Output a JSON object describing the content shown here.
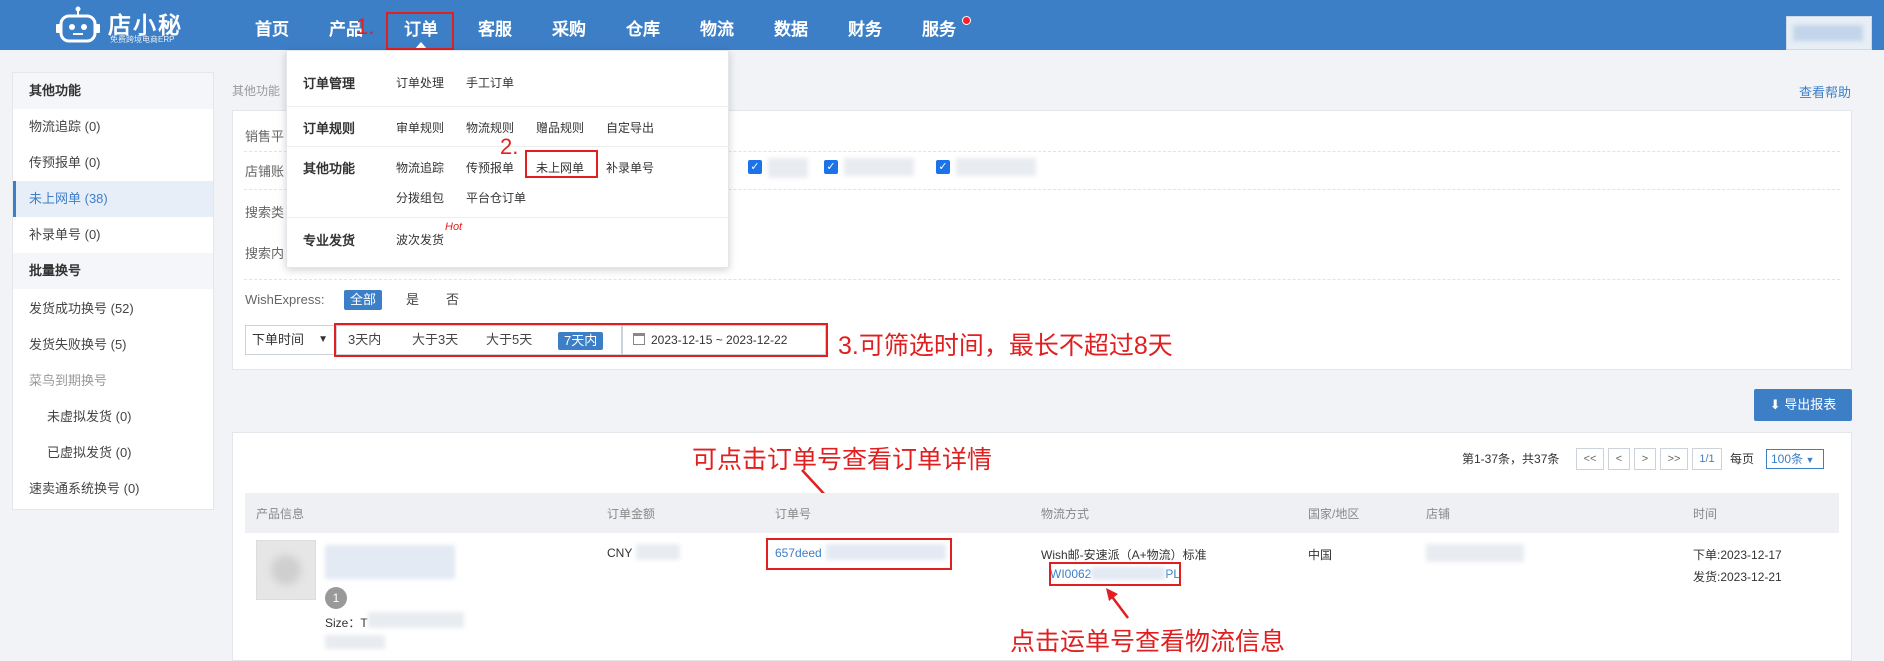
{
  "header": {
    "logo_name": "店小秘",
    "logo_sub": "免费跨境电商ERP",
    "nav": [
      "首页",
      "产品",
      "订单",
      "客服",
      "采购",
      "仓库",
      "物流",
      "数据",
      "财务",
      "服务"
    ]
  },
  "annotations": {
    "step1": "1.",
    "step2": "2.",
    "step3_note": "3.可筛选时间，最长不超过8天",
    "order_note": "可点击订单号查看订单详情",
    "tracking_note": "点击运单号查看物流信息"
  },
  "dropdown": {
    "groups": [
      {
        "title": "订单管理",
        "items": [
          "订单处理",
          "手工订单"
        ]
      },
      {
        "title": "订单规则",
        "items": [
          "审单规则",
          "物流规则",
          "赠品规则",
          "自定导出"
        ]
      },
      {
        "title": "其他功能",
        "items": [
          "物流追踪",
          "传预报单",
          "未上网单",
          "补录单号",
          "分拨组包",
          "平台仓订单"
        ]
      },
      {
        "title": "专业发货",
        "items": [
          "波次发货"
        ],
        "tag": "Hot"
      }
    ]
  },
  "sidebar": {
    "section1_title": "其他功能",
    "section1_items": [
      "物流追踪 (0)",
      "传预报单 (0)",
      "未上网单 (38)",
      "补录单号 (0)"
    ],
    "section2_title": "批量换号",
    "section2_items": [
      "发货成功换号 (52)",
      "发货失败换号 (5)",
      "菜鸟到期换号",
      "未虚拟发货 (0)",
      "已虚拟发货 (0)",
      "速卖通系统换号 (0)"
    ]
  },
  "page": {
    "breadcrumb": "其他功能",
    "help": "查看帮助"
  },
  "filters": {
    "sales_platform_label": "销售平",
    "store_label": "店铺账",
    "search_type_label": "搜索类",
    "search_content_label": "搜索内",
    "wishexpress_label": "WishExpress:",
    "wishexpress_options": [
      "全部",
      "是",
      "否"
    ],
    "time_select": "下单时间",
    "quick_ranges": [
      "3天内",
      "大于3天",
      "大于5天",
      "7天内"
    ],
    "date_range": "2023-12-15 ~ 2023-12-22"
  },
  "toolbar": {
    "export_label": "导出报表"
  },
  "pager": {
    "info": "第1-37条，共37条",
    "buttons": [
      "<<",
      "<",
      ">",
      ">>"
    ],
    "page": "1/1",
    "per_page_label": "每页",
    "per_page_value": "100条"
  },
  "table": {
    "headers": [
      "产品信息",
      "订单金额",
      "订单号",
      "物流方式",
      "国家/地区",
      "店铺",
      "时间"
    ],
    "row": {
      "qty": "1",
      "size_label": "Size：T",
      "amount": "CNY",
      "order_no": "657deed",
      "shipping_method": "Wish邮-安速派（A+物流）标准",
      "tracking_prefix": "WI0062",
      "tracking_suffix": "PL",
      "country": "中国",
      "order_time": "下单:2023-12-17",
      "ship_time": "发货:2023-12-21"
    }
  }
}
